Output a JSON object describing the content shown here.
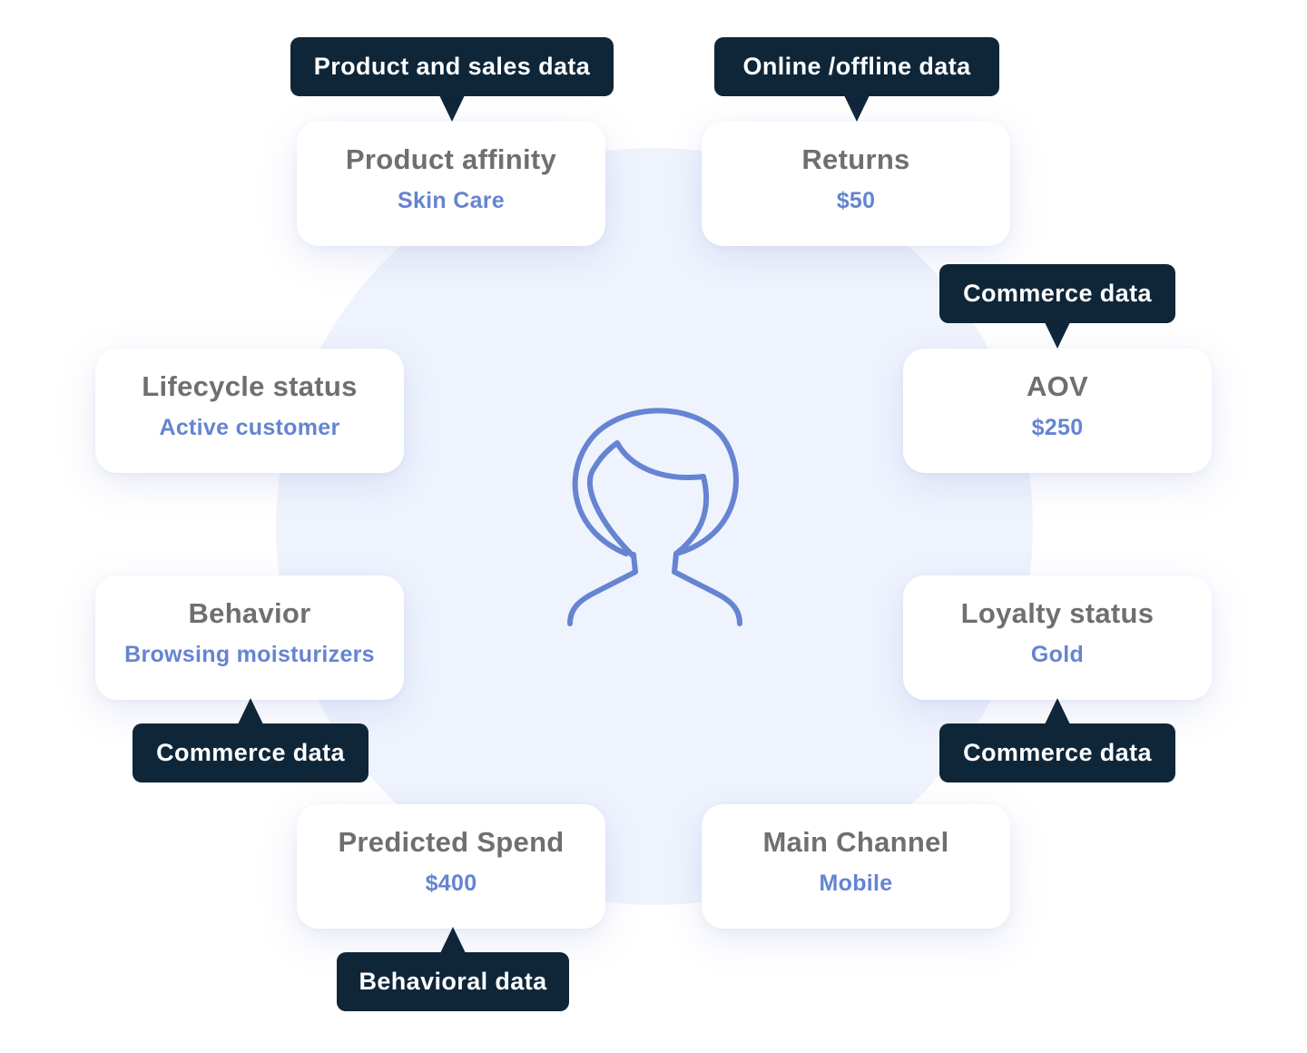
{
  "colors": {
    "background_circle": "#eff3fd",
    "icon_stroke": "#6584d1",
    "card_label": "#6f6f6f",
    "card_value": "#6584d1",
    "tooltip_bg": "#0f2639",
    "tooltip_text": "#ffffff"
  },
  "center_icon": "woman-profile-icon",
  "cards": [
    {
      "id": "product-affinity",
      "label": "Product affinity",
      "value": "Skin Care",
      "source": "Product and sales data"
    },
    {
      "id": "returns",
      "label": "Returns",
      "value": "$50",
      "source": "Online /offline data"
    },
    {
      "id": "aov",
      "label": "AOV",
      "value": "$250",
      "source": "Commerce data"
    },
    {
      "id": "loyalty-status",
      "label": "Loyalty status",
      "value": "Gold",
      "source": "Commerce data"
    },
    {
      "id": "main-channel",
      "label": "Main Channel",
      "value": "Mobile",
      "source": null
    },
    {
      "id": "predicted-spend",
      "label": "Predicted Spend",
      "value": "$400",
      "source": "Behavioral data"
    },
    {
      "id": "behavior",
      "label": "Behavior",
      "value": "Browsing moisturizers",
      "source": "Commerce data"
    },
    {
      "id": "lifecycle-status",
      "label": "Lifecycle status",
      "value": "Active customer",
      "source": null
    }
  ]
}
